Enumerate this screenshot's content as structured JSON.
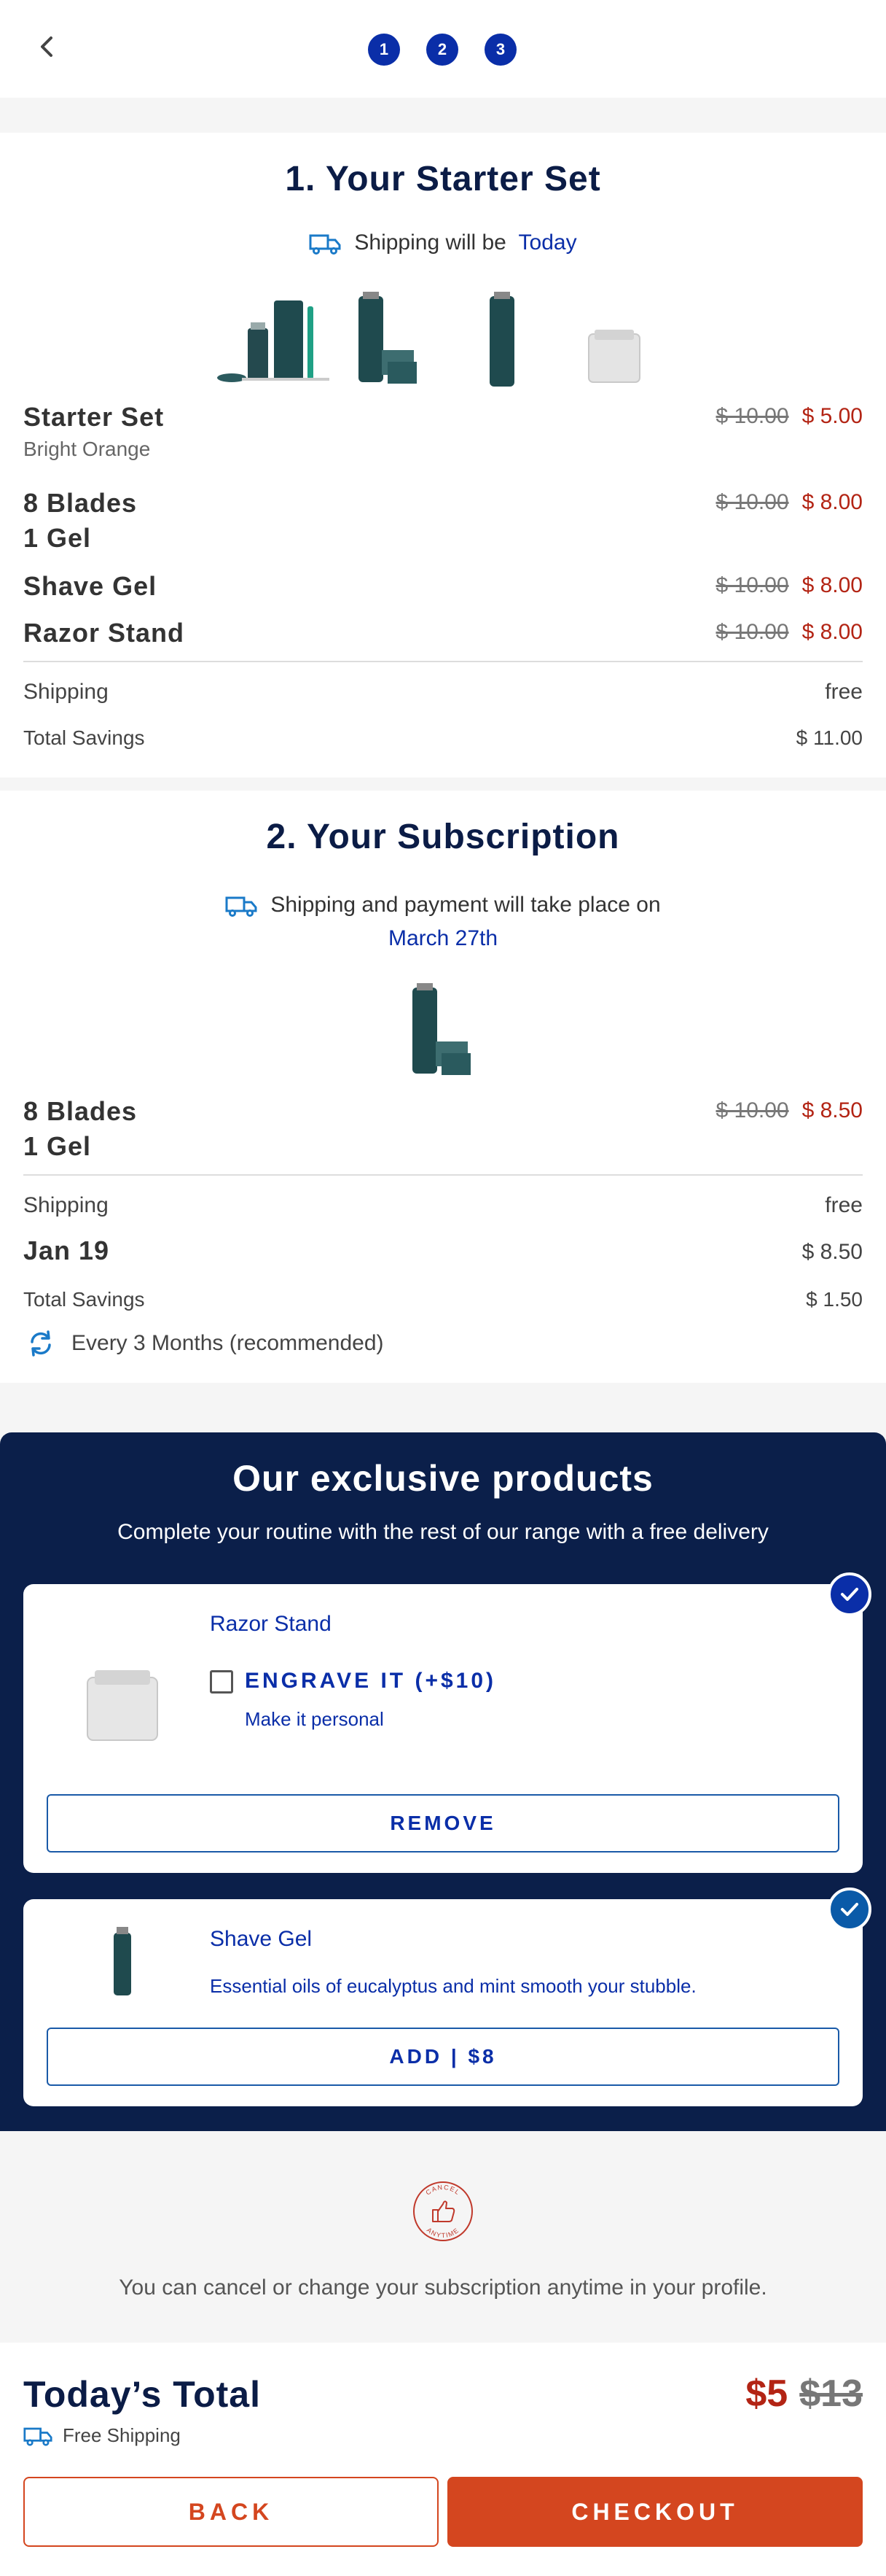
{
  "steps": [
    "1",
    "2",
    "3"
  ],
  "starter": {
    "title": "1. Your Starter Set",
    "shipping_prefix": "Shipping will be",
    "shipping_when": "Today",
    "items": [
      {
        "name": "Starter Set",
        "sub": "Bright Orange",
        "old": "$ 10.00",
        "new": "$ 5.00"
      },
      {
        "name": "8 Blades",
        "sub2": "1 Gel",
        "old": "$ 10.00",
        "new": "$ 8.00"
      },
      {
        "name": "Shave Gel",
        "old": "$ 10.00",
        "new": "$ 8.00"
      },
      {
        "name": "Razor Stand",
        "old": "$ 10.00",
        "new": "$ 8.00"
      }
    ],
    "shipping_label": "Shipping",
    "shipping_value": "free",
    "savings_label": "Total Savings",
    "savings_value": "$ 11.00"
  },
  "subscription": {
    "title": "2. Your Subscription",
    "shipping_text": "Shipping and payment will take place on",
    "shipping_date": "March 27th",
    "item": {
      "name": "8 Blades",
      "sub2": "1 Gel",
      "old": "$ 10.00",
      "new": "$ 8.50"
    },
    "shipping_label": "Shipping",
    "shipping_value": "free",
    "date_label": "Jan 19",
    "date_value": "$ 8.50",
    "savings_label": "Total Savings",
    "savings_value": "$ 1.50",
    "frequency": "Every 3 Months (recommended)"
  },
  "exclusive": {
    "title": "Our exclusive products",
    "subtitle": "Complete your routine with the rest of our range with a free delivery",
    "products": [
      {
        "name": "Razor Stand",
        "engrave": "ENGRAVE IT (+$10)",
        "engrave_sub": "Make it personal",
        "button": "REMOVE"
      },
      {
        "name": "Shave Gel",
        "desc": "Essential oils of eucalyptus and mint smooth your stubble.",
        "button": "ADD | $8"
      }
    ]
  },
  "cancel": {
    "badge_top": "CANCEL",
    "badge_bottom": "ANYTIME",
    "text": "You can cancel or change your subscription anytime in your profile."
  },
  "footer": {
    "total_label": "Today’s Total",
    "free_shipping": "Free Shipping",
    "price_new": "$5",
    "price_old": "$13",
    "back": "BACK",
    "checkout": "CHECKOUT"
  },
  "colors": {
    "navy": "#0b1f4a",
    "accent_blue": "#0a2ea8",
    "orange": "#d4461f",
    "red": "#b32414"
  }
}
